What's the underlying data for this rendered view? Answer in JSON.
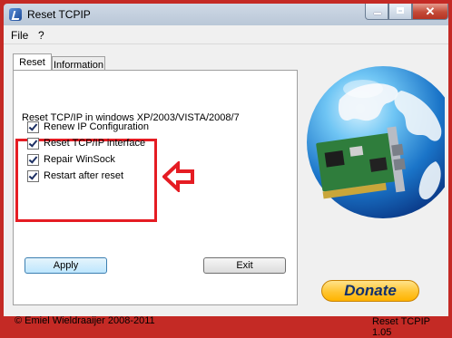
{
  "window": {
    "title": "Reset TCPIP",
    "close_symbol": "✕"
  },
  "menu": [
    "File",
    "?"
  ],
  "tabs": [
    "Reset",
    "Information"
  ],
  "heading": "Reset TCP/IP in windows XP/2003/VISTA/2008/7",
  "options": [
    {
      "label": "Renew IP Configuration",
      "checked": true
    },
    {
      "label": "Reset TCP/IP interface",
      "checked": true
    },
    {
      "label": "Repair WinSock",
      "checked": true
    },
    {
      "label": "Restart after reset",
      "checked": true
    }
  ],
  "buttons": {
    "apply": "Apply",
    "exit": "Exit",
    "donate": "Donate"
  },
  "footer": {
    "copyright": "© Emiel Wieldraaijer 2008-2011",
    "version": "Reset TCPIP 1.05"
  },
  "colors": {
    "highlight_red": "#e51c23",
    "border_red": "#c42a25",
    "donate_yellow": "#ffc531"
  },
  "icons": [
    "app-icon",
    "globe-network-card-icon",
    "arrow-left-icon"
  ]
}
